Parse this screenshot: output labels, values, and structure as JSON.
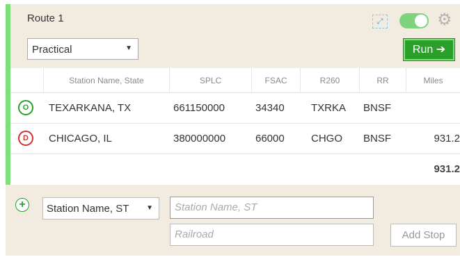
{
  "route": {
    "title": "Route 1",
    "mode_selected": "Practical",
    "run_label": "Run ➔"
  },
  "header_icons": {
    "route_icon": "route-map-icon",
    "toggle_state": "on",
    "settings_icon": "gear-icon"
  },
  "table": {
    "columns": [
      "Station Name, State",
      "SPLC",
      "FSAC",
      "R260",
      "RR",
      "Miles"
    ],
    "rows": [
      {
        "stop_type": "O",
        "station": "TEXARKANA, TX",
        "splc": "661150000",
        "fsac": "34340",
        "r260": "TXRKA",
        "rr": "BNSF",
        "miles": ""
      },
      {
        "stop_type": "D",
        "station": "CHICAGO, IL",
        "splc": "380000000",
        "fsac": "66000",
        "r260": "CHGO",
        "rr": "BNSF",
        "miles": "931.2"
      }
    ],
    "total_miles": "931.2"
  },
  "add_stop": {
    "station_type_selected": "Station Name, ST",
    "station_placeholder": "Station Name, ST",
    "railroad_placeholder": "Railroad",
    "add_stop_label": "Add Stop"
  },
  "colors": {
    "accent_green": "#7de07d",
    "run_green": "#2aa02a",
    "panel_beige": "#f2ebe0",
    "destination_red": "#d03030"
  }
}
